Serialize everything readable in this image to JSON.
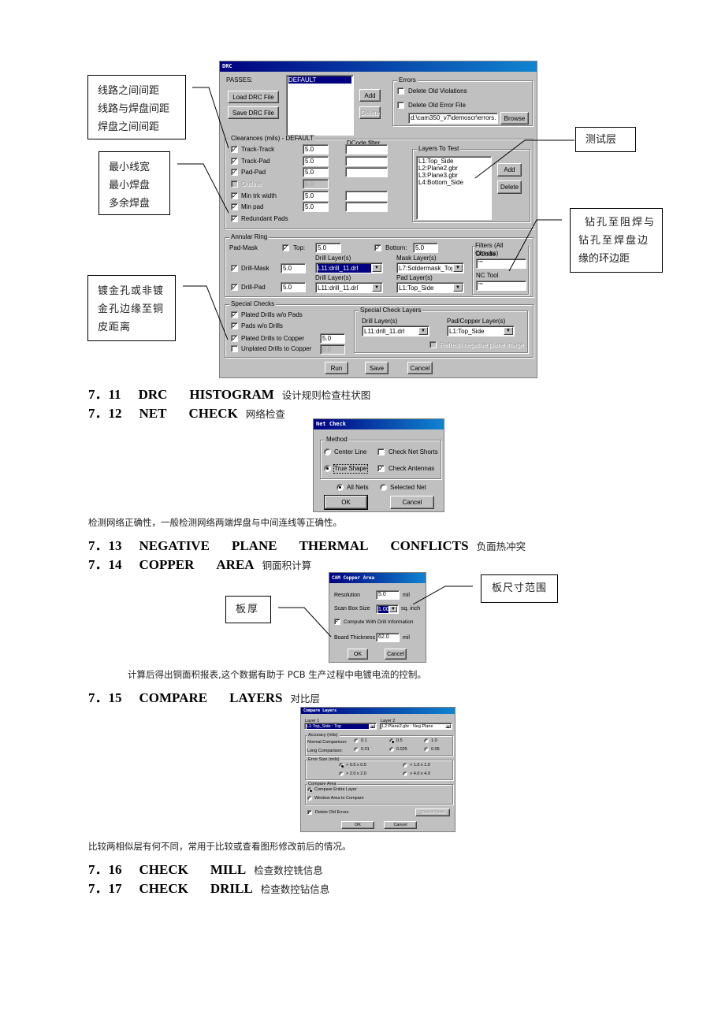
{
  "drc_dialog": {
    "title": "DRC",
    "passes_label": "PASSES:",
    "passes_list": [
      "DEFAULT"
    ],
    "load_button": "Load DRC File",
    "save_file_button": "Save DRC File",
    "add_button": "Add",
    "delete_button": "Delete",
    "errors": {
      "group_label": "Errors",
      "delete_old_violations": {
        "label": "Delete Old Violations",
        "checked": false
      },
      "delete_old_error_file": {
        "label": "Delete Old Error File",
        "checked": false
      },
      "path": "d:\\cam350_v7\\demoscr\\errors.",
      "browse_button": "Browse"
    },
    "clearances": {
      "group_label": "Clearances (mils) - DEFAULT",
      "dcode_filter_label": "DCode filter",
      "rows": [
        {
          "label": "Track-Track",
          "checked": true,
          "value": "5.0",
          "dcode": "",
          "enabled": true
        },
        {
          "label": "Track-Pad",
          "checked": true,
          "value": "5.0",
          "dcode": "",
          "enabled": true
        },
        {
          "label": "Pad-Pad",
          "checked": true,
          "value": "5.0",
          "dcode": "",
          "enabled": true
        },
        {
          "label": "Outline",
          "checked": false,
          "value": "5.0",
          "dcode": null,
          "enabled": false
        },
        {
          "label": "Min trk width",
          "checked": true,
          "value": "5.0",
          "dcode": "",
          "enabled": true
        },
        {
          "label": "Min pad",
          "checked": true,
          "value": "5.0",
          "dcode": "",
          "enabled": true
        },
        {
          "label": "Redundant Pads",
          "checked": true,
          "value": null,
          "dcode": null,
          "enabled": true
        }
      ]
    },
    "layers_to_test": {
      "group_label": "Layers To Test",
      "items": [
        "L1:Top_Side",
        "L2:Plane2.gbr",
        "L3:Plane3.gbr",
        "L4:Bottom_Side"
      ],
      "add_button": "Add",
      "delete_button": "Delete"
    },
    "annular_ring": {
      "group_label": "Annular Ring",
      "pad_mask_label": "Pad-Mask",
      "top": {
        "label": "Top:",
        "checked": true,
        "value": "5.0"
      },
      "bottom": {
        "label": "Bottom:",
        "checked": true,
        "value": "5.0"
      },
      "drill_mask": {
        "label": "Drill-Mask",
        "checked": true,
        "value": "5.0",
        "drill_layer_label": "Drill Layer(s)",
        "drill_layer": "L11:drill_11.drl",
        "mask_layer_label": "Mask Layer(s)",
        "mask_layer": "L7:Soldermask_Top"
      },
      "drill_pad": {
        "label": "Drill-Pad",
        "checked": true,
        "value": "5.0",
        "drill_layer_label": "Drill Layer(s)",
        "drill_layer": "L11:drill_11.drl",
        "pad_layer_label": "Pad Layer(s)",
        "pad_layer": "L1:Top_Side"
      }
    },
    "filters": {
      "group_label": "Filters (All Checks)",
      "dcode_label": "DCode",
      "dcode_value": "\"\"",
      "nc_tool_label": "NC Tool",
      "nc_tool_value": "\"\""
    },
    "special_checks": {
      "group_label": "Special Checks",
      "items": [
        {
          "label": "Plated Drills w/o Pads",
          "checked": true
        },
        {
          "label": "Pads w/o Drills",
          "checked": true
        },
        {
          "label": "Plated Drills to Copper",
          "checked": true,
          "value": "5.0"
        },
        {
          "label": "Unplated Drills to Copper",
          "checked": false,
          "value": "0.0"
        }
      ]
    },
    "special_check_layers": {
      "group_label": "Special Check Layers",
      "drill_label": "Drill Layer(s)",
      "drill_value": "L11:drill_11.drl",
      "pad_label": "Pad/Copper Layer(s)",
      "pad_value": "L1:Top_Side",
      "refresh_label": "Refresh negative plane image",
      "refresh_checked": false
    },
    "run_button": "Run",
    "save_button": "Save",
    "cancel_button": "Cancel"
  },
  "callouts": {
    "clearance": [
      "线路之间间距",
      "线路与焊盘间距",
      "焊盘之间间距"
    ],
    "minimum": [
      "最小线宽",
      "最小焊盘",
      "多余焊盘"
    ],
    "layers": [
      "测试层"
    ],
    "annular": [
      "钻孔至阻焊与",
      "钻孔至焊盘边",
      "缘的环边距"
    ],
    "plated": [
      "镀金孔或非镀",
      "金孔边缘至铜",
      "皮距离"
    ],
    "board_thickness": [
      "板厚"
    ],
    "board_size": [
      "板尺寸范围"
    ]
  },
  "headings": [
    {
      "num": "7．11",
      "words": [
        "DRC",
        "HISTOGRAM"
      ],
      "cn": "设计规则检查柱状图"
    },
    {
      "num": "7．12",
      "words": [
        "NET",
        "CHECK"
      ],
      "cn": "网络检查"
    },
    {
      "num": "7．13",
      "words": [
        "NEGATIVE",
        "PLANE",
        "THERMAL",
        "CONFLICTS"
      ],
      "cn": "负面热冲突"
    },
    {
      "num": "7．14",
      "words": [
        "COPPER",
        "AREA"
      ],
      "cn": "铜面积计算"
    },
    {
      "num": "7．15",
      "words": [
        "COMPARE",
        "LAYERS"
      ],
      "cn": "对比层"
    },
    {
      "num": "7．16",
      "words": [
        "CHECK",
        "MILL"
      ],
      "cn": "检查数控铣信息"
    },
    {
      "num": "7．17",
      "words": [
        "CHECK",
        "DRILL"
      ],
      "cn": "检查数控钻信息"
    }
  ],
  "paragraphs": {
    "net_check_desc": "检测网络正确性，一般检测网络两端焊盘与中间连线等正确性。",
    "copper_area_desc": "计算后得出铜面积报表,这个数据有助于 PCB 生产过程中电镀电流的控制。",
    "compare_desc": "比较两相似层有何不同，常用于比较或查看图形修改前后的情况。"
  },
  "net_check_dialog": {
    "title": "Net Check",
    "method_label": "Method",
    "center_line": {
      "label": "Center Line",
      "selected": false
    },
    "true_shape": {
      "label": "True Shape",
      "selected": true
    },
    "check_net_shorts": {
      "label": "Check Net Shorts",
      "checked": false
    },
    "check_antennas": {
      "label": "Check Antennas",
      "checked": true
    },
    "all_nets": {
      "label": "All Nets",
      "selected": true
    },
    "selected_net": {
      "label": "Selected Net",
      "selected": false
    },
    "ok_button": "OK",
    "cancel_button": "Cancel"
  },
  "copper_area_dialog": {
    "title": "CAM Copper Area",
    "resolution_label": "Resolution",
    "resolution_value": "5.0",
    "resolution_unit": "mil",
    "scan_box_label": "Scan Box Size",
    "scan_box_value": "1.00",
    "scan_box_unit": "sq. inch",
    "compute_drill": {
      "label": "Compute With Drill Information",
      "checked": true
    },
    "board_thickness_label": "Board Thickness",
    "board_thickness_value": "62.0",
    "board_thickness_unit": "mil",
    "ok_button": "OK",
    "cancel_button": "Cancel"
  },
  "compare_dialog": {
    "title": "Compare Layers",
    "layer1_label": "Layer 1",
    "layer1_value": "L1:Top_Side : Top",
    "layer2_label": "Layer 2",
    "layer2_value": "L2:Plane2.gbr : Neg Plane",
    "accuracy_label": "Accuracy (mils)",
    "normal_label": "Normal Comparison:",
    "normal_options": [
      {
        "label": "0.1",
        "selected": false
      },
      {
        "label": "0.5",
        "selected": true
      },
      {
        "label": "1.0",
        "selected": false
      }
    ],
    "long_label": "Long Comparison:",
    "long_options": [
      {
        "label": "0.01",
        "selected": false
      },
      {
        "label": "0.025",
        "selected": false
      },
      {
        "label": "0.05",
        "selected": false
      }
    ],
    "error_size_label": "Error Size (mils)",
    "error_options": [
      {
        "label": "> 0.5 x 0.5",
        "selected": true
      },
      {
        "label": "> 1.0 x 1.0",
        "selected": false
      },
      {
        "label": "> 2.0 x 2.0",
        "selected": false
      },
      {
        "label": "> 4.0 x 4.0",
        "selected": false
      }
    ],
    "compare_area_label": "Compare Area",
    "entire_layer": {
      "label": "Compare Entire Layer",
      "selected": true
    },
    "window_area": {
      "label": "Window Area to Compare",
      "selected": false
    },
    "delete_old_errors": {
      "label": "Delete Old Errors",
      "checked": true
    },
    "control_panel_button": "Control Panel",
    "ok_button": "OK",
    "cancel_button": "Cancel"
  }
}
